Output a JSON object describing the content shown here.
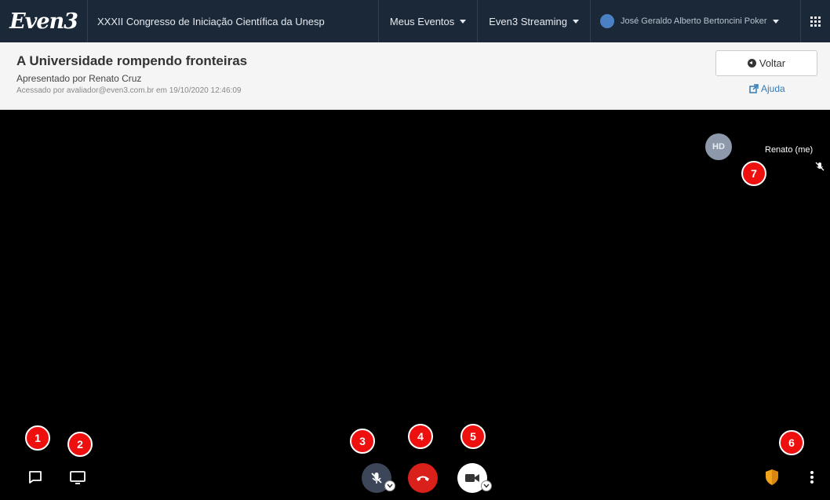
{
  "navbar": {
    "logo": "Even3",
    "event_title": "XXXII Congresso de Iniciação Científica da Unesp",
    "meus_eventos": "Meus Eventos",
    "streaming": "Even3 Streaming",
    "user_name": "José Geraldo Alberto Bertoncini Poker"
  },
  "session": {
    "title": "A Universidade rompendo fronteiras",
    "presenter": "Apresentado por Renato Cruz",
    "access": "Acessado por avaliador@even3.com.br em 19/10/2020 12:46:09",
    "back_label": "Voltar",
    "help_label": "Ajuda"
  },
  "participant": {
    "initials": "HD",
    "name": "Renato (me)"
  },
  "badges": {
    "b1": "1",
    "b2": "2",
    "b3": "3",
    "b4": "4",
    "b5": "5",
    "b6": "6",
    "b7": "7"
  },
  "colors": {
    "navbar": "#1b2838",
    "badge": "#ee0f0f",
    "hangup": "#d9201b",
    "shield": "#f2a31b"
  },
  "icons": [
    "chat-icon",
    "screen-share-icon",
    "mic-muted-icon",
    "hangup-icon",
    "camera-icon",
    "shield-icon",
    "more-vertical-icon",
    "grid-apps-icon",
    "back-icon",
    "external-link-icon"
  ]
}
